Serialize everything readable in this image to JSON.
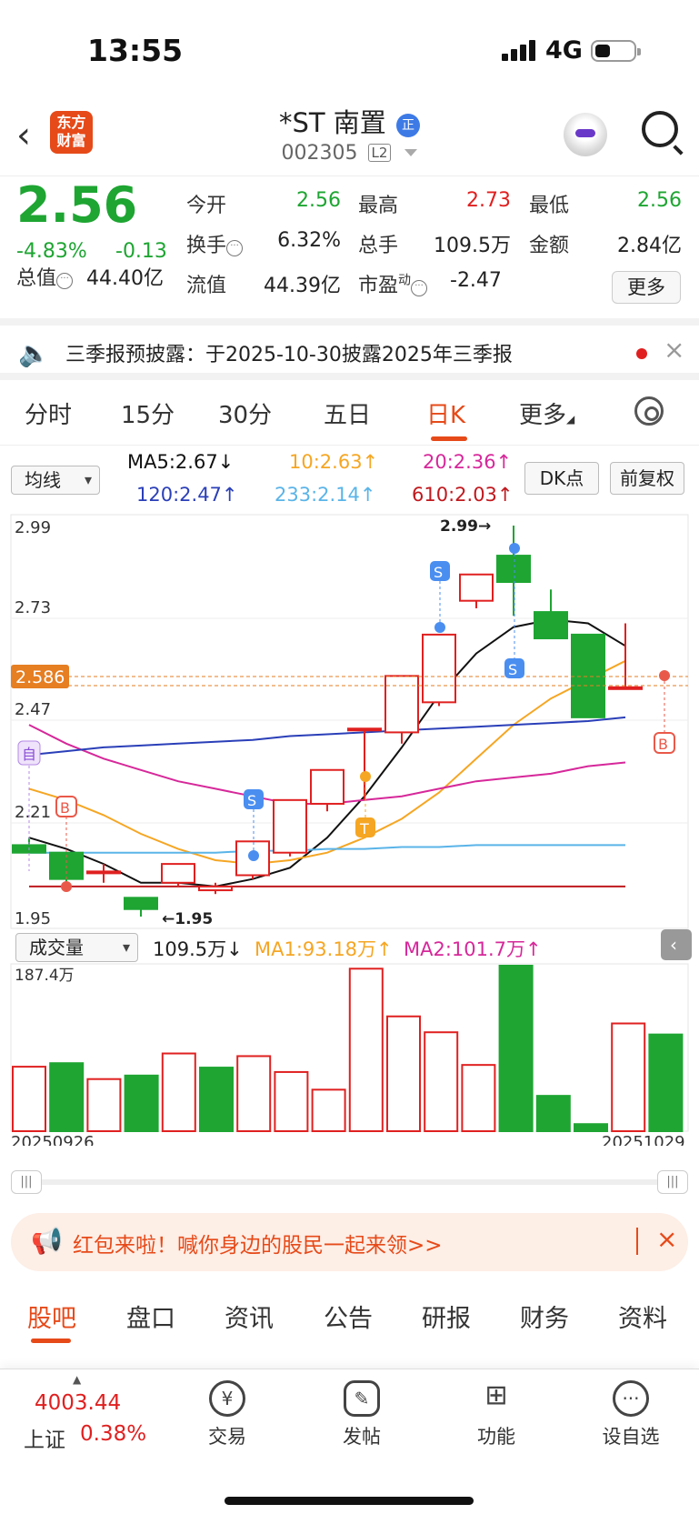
{
  "status": {
    "time": "13:55",
    "network": "4G"
  },
  "header": {
    "logo_line1": "东方",
    "logo_line2": "财富",
    "stock_name": "*ST 南置",
    "badge": "正",
    "code": "002305",
    "level": "L2"
  },
  "quote": {
    "price": "2.56",
    "change_pct": "-4.83%",
    "change": "-0.13",
    "open_label": "今开",
    "open": "2.56",
    "high_label": "最高",
    "high": "2.73",
    "low_label": "最低",
    "low": "2.56",
    "turnover_label": "换手",
    "turnover": "6.32%",
    "volume_label": "总手",
    "volume": "109.5万",
    "amount_label": "金额",
    "amount": "2.84亿",
    "mktcap_label": "总值",
    "mktcap": "44.40亿",
    "float_label": "流值",
    "float": "44.39亿",
    "pe_label": "市盈",
    "pe_sup": "动",
    "pe": "-2.47",
    "more": "更多"
  },
  "notice": {
    "text": "三季报预披露：于2025-10-30披露2025年三季报"
  },
  "tabs": [
    "分时",
    "15分",
    "30分",
    "五日",
    "日K",
    "更多"
  ],
  "ma_bar": {
    "select": "均线",
    "ma5": "MA5:2.67↓",
    "ma10": "10:2.63↑",
    "ma20": "20:2.36↑",
    "ma120": "120:2.47↑",
    "ma233": "233:2.14↑",
    "ma610": "610:2.03↑",
    "dk_btn": "DK点",
    "adj_btn": "前复权"
  },
  "colors": {
    "up": "#e02020",
    "down": "#1ea532",
    "accent": "#e64a19",
    "ma5": "#111111",
    "ma10": "#f5a623",
    "ma20": "#d6289a",
    "ma120": "#2a3fb8",
    "ma233": "#5ab4e8",
    "ma610": "#c0191e"
  },
  "price_axis": {
    "top": "2.99",
    "l1": "2.73",
    "l2": "2.47",
    "l3": "2.21",
    "bottom": "1.95",
    "current": "2.586"
  },
  "marks": {
    "high_label": "2.99→",
    "low_label": "←1.95",
    "s": "S",
    "b": "B",
    "t": "T",
    "zi": "自"
  },
  "volume": {
    "select": "成交量",
    "vol": "109.5万↓",
    "ma1": "MA1:93.18万↑",
    "ma2": "MA2:101.7万↑",
    "max_label": "187.4万",
    "start_date": "20250926",
    "end_date": "20251029"
  },
  "chart_data": {
    "type": "candlestick",
    "ylim": [
      1.95,
      2.99
    ],
    "candles": [
      {
        "open": 2.14,
        "close": 2.12,
        "high": 2.16,
        "low": 2.12
      },
      {
        "open": 2.12,
        "close": 2.05,
        "high": 2.12,
        "low": 2.04
      },
      {
        "open": 2.07,
        "close": 2.07,
        "high": 2.09,
        "low": 2.04
      },
      {
        "open": 2.0,
        "close": 1.97,
        "high": 2.0,
        "low": 1.95
      },
      {
        "open": 2.04,
        "close": 2.09,
        "high": 2.09,
        "low": 2.03
      },
      {
        "open": 2.02,
        "close": 2.03,
        "high": 2.04,
        "low": 2.01
      },
      {
        "open": 2.06,
        "close": 2.15,
        "high": 2.15,
        "low": 2.05
      },
      {
        "open": 2.12,
        "close": 2.26,
        "high": 2.26,
        "low": 2.11
      },
      {
        "open": 2.25,
        "close": 2.34,
        "high": 2.34,
        "low": 2.23
      },
      {
        "open": 2.45,
        "close": 2.45,
        "high": 2.45,
        "low": 2.26
      },
      {
        "open": 2.44,
        "close": 2.59,
        "high": 2.59,
        "low": 2.41
      },
      {
        "open": 2.52,
        "close": 2.7,
        "high": 2.7,
        "low": 2.51
      },
      {
        "open": 2.79,
        "close": 2.86,
        "high": 2.86,
        "low": 2.77
      },
      {
        "open": 2.91,
        "close": 2.84,
        "high": 2.99,
        "low": 2.75
      },
      {
        "open": 2.76,
        "close": 2.69,
        "high": 2.82,
        "low": 2.69
      },
      {
        "open": 2.7,
        "close": 2.48,
        "high": 2.7,
        "low": 2.48
      },
      {
        "open": 2.56,
        "close": 2.56,
        "high": 2.73,
        "low": 2.56
      }
    ],
    "volume_max": 187.4,
    "volume_unit": "万",
    "volumes": [
      {
        "value": 73,
        "up": true
      },
      {
        "value": 77,
        "up": false
      },
      {
        "value": 59,
        "up": true
      },
      {
        "value": 63,
        "up": false
      },
      {
        "value": 88,
        "up": true
      },
      {
        "value": 72,
        "up": false
      },
      {
        "value": 85,
        "up": true
      },
      {
        "value": 67,
        "up": true
      },
      {
        "value": 47,
        "up": true
      },
      {
        "value": 184,
        "up": true
      },
      {
        "value": 130,
        "up": true
      },
      {
        "value": 112,
        "up": true
      },
      {
        "value": 75,
        "up": true
      },
      {
        "value": 187.4,
        "up": false
      },
      {
        "value": 40,
        "up": false
      },
      {
        "value": 8,
        "up": false
      },
      {
        "value": 122,
        "up": true
      },
      {
        "value": 109.5,
        "up": false
      }
    ],
    "ma_lines": {
      "ma5": [
        2.16,
        2.13,
        2.09,
        2.04,
        2.04,
        2.03,
        2.05,
        2.08,
        2.16,
        2.27,
        2.4,
        2.54,
        2.65,
        2.72,
        2.74,
        2.73,
        2.67
      ],
      "ma10": [
        2.29,
        2.26,
        2.22,
        2.17,
        2.13,
        2.1,
        2.09,
        2.1,
        2.12,
        2.16,
        2.21,
        2.28,
        2.37,
        2.46,
        2.53,
        2.58,
        2.63
      ],
      "ma20": [
        2.46,
        2.41,
        2.37,
        2.34,
        2.31,
        2.29,
        2.27,
        2.25,
        2.25,
        2.26,
        2.27,
        2.29,
        2.31,
        2.32,
        2.33,
        2.35,
        2.36
      ],
      "ma120": [
        2.38,
        2.39,
        2.4,
        2.405,
        2.41,
        2.415,
        2.42,
        2.43,
        2.435,
        2.44,
        2.445,
        2.45,
        2.455,
        2.46,
        2.465,
        2.47,
        2.48
      ],
      "ma233": [
        2.12,
        2.12,
        2.12,
        2.12,
        2.12,
        2.12,
        2.125,
        2.125,
        2.13,
        2.13,
        2.135,
        2.135,
        2.14,
        2.14,
        2.14,
        2.14,
        2.14
      ],
      "ma610": [
        2.03,
        2.03,
        2.03,
        2.03,
        2.03,
        2.03,
        2.03,
        2.03,
        2.03,
        2.03,
        2.03,
        2.03,
        2.03,
        2.03,
        2.03,
        2.03,
        2.03
      ]
    }
  },
  "promo": {
    "text": "红包来啦！喊你身边的股民一起来领>>"
  },
  "bottom_tabs": [
    "股吧",
    "盘口",
    "资讯",
    "公告",
    "研报",
    "财务",
    "资料"
  ],
  "dock": {
    "index_value": "4003.44",
    "index_name": "上证",
    "index_pct": "0.38%",
    "items": [
      {
        "label": "交易",
        "icon": "yen"
      },
      {
        "label": "发帖",
        "icon": "edit"
      },
      {
        "label": "功能",
        "icon": "grid"
      },
      {
        "label": "设自选",
        "icon": "more"
      }
    ]
  }
}
